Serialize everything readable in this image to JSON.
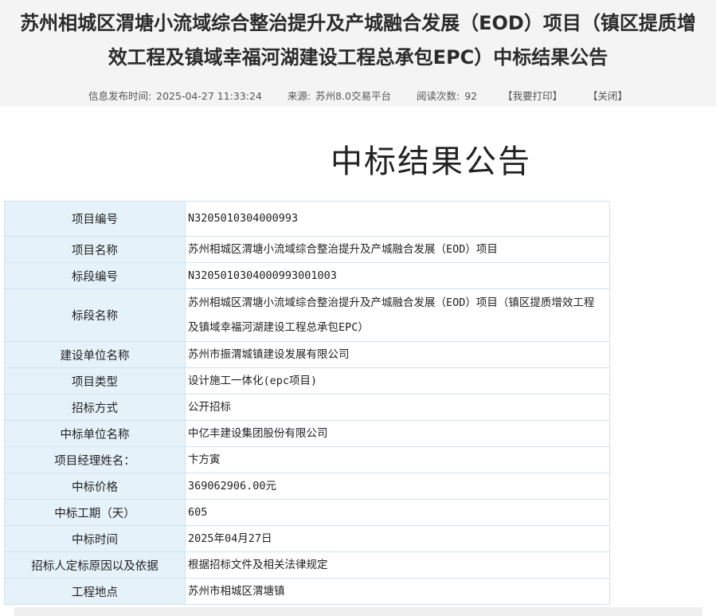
{
  "notice": {
    "title_line1": "苏州相城区渭塘小流域综合整治提升及产城融合发展（EOD）项目（镇区提质增",
    "title_line2": "效工程及镇域幸福河湖建设工程总承包EPC）中标结果公告",
    "meta": {
      "publish_label": "信息发布时间:",
      "publish_time": "2025-04-27 11:33:24",
      "source_label": "来源:",
      "source": "苏州8.0交易平台",
      "views_label": "阅读次数:",
      "views": "92",
      "print_link": "【我要打印】",
      "close_link": "【关闭】"
    }
  },
  "document": {
    "heading": "中标结果公告",
    "rows": [
      {
        "label": "项目编号",
        "value": "N3205010304000993"
      },
      {
        "label": "项目名称",
        "value": "苏州相城区渭塘小流域综合整治提升及产城融合发展（EOD）项目"
      },
      {
        "label": "标段编号",
        "value": "N3205010304000993001003"
      },
      {
        "label": "标段名称",
        "value": "苏州相城区渭塘小流域综合整治提升及产城融合发展（EOD）项目（镇区提质增效工程及镇域幸福河湖建设工程总承包EPC）"
      },
      {
        "label": "建设单位名称",
        "value": "苏州市振渭城镇建设发展有限公司"
      },
      {
        "label": "项目类型",
        "value": "设计施工一体化(epc项目)"
      },
      {
        "label": "招标方式",
        "value": "公开招标"
      },
      {
        "label": "中标单位名称",
        "value": "中亿丰建设集团股份有限公司"
      },
      {
        "label": "项目经理姓名：",
        "value": "卞方寅"
      },
      {
        "label": "中标价格",
        "value": "369062906.00元"
      },
      {
        "label": "中标工期（天）",
        "value": "605"
      },
      {
        "label": "中标时间",
        "value": "2025年04月27日"
      },
      {
        "label": "招标人定标原因以及依据",
        "value": "根据招标文件及相关法律规定"
      },
      {
        "label": "工程地点",
        "value": "苏州市相城区渭塘镇"
      }
    ]
  }
}
